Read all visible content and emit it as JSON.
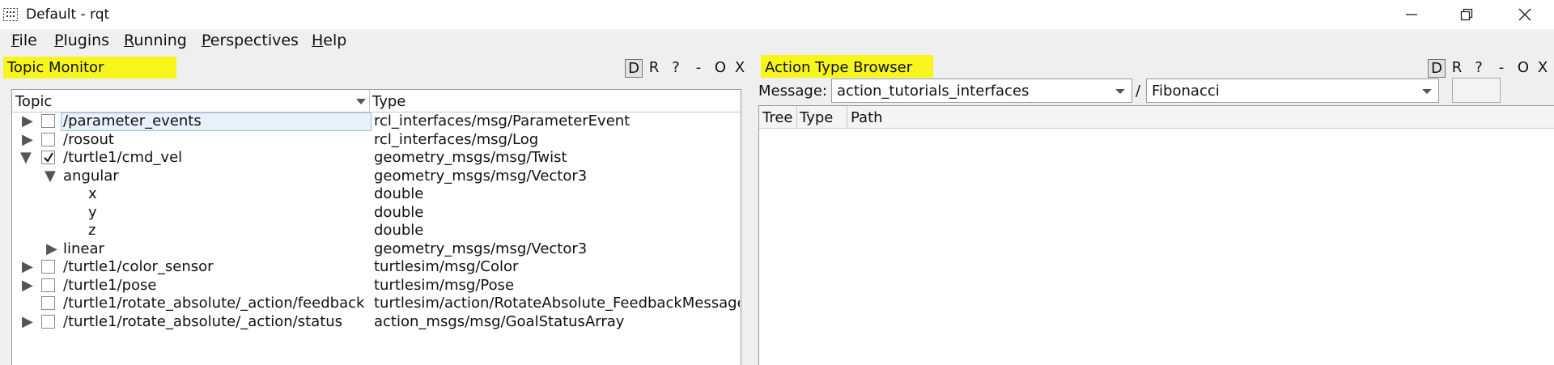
{
  "window": {
    "title": "Default - rqt",
    "minimize_glyph": "–",
    "restore_glyph": "❐",
    "close_glyph": "✕"
  },
  "menubar": [
    {
      "mnemonic": "F",
      "rest": "ile"
    },
    {
      "mnemonic": "P",
      "rest": "lugins"
    },
    {
      "mnemonic": "R",
      "rest": "unning"
    },
    {
      "mnemonic": "P",
      "rest": "erspectives"
    },
    {
      "mnemonic": "H",
      "rest": "elp"
    }
  ],
  "highlight_color": "#f6f61a",
  "topic_monitor": {
    "title": "Topic Monitor",
    "buttons": {
      "d": "D",
      "r": "R",
      "help": "?",
      "minimize": "-",
      "restore": "O",
      "close": "X"
    },
    "columns": {
      "topic": "Topic",
      "type": "Type"
    },
    "rows": [
      {
        "topic": "/parameter_events",
        "type": "rcl_interfaces/msg/ParameterEvent"
      },
      {
        "topic": "/rosout",
        "type": "rcl_interfaces/msg/Log"
      },
      {
        "topic": "/turtle1/cmd_vel",
        "type": "geometry_msgs/msg/Twist"
      },
      {
        "topic": "angular",
        "type": "geometry_msgs/msg/Vector3"
      },
      {
        "topic": "x",
        "type": "double"
      },
      {
        "topic": "y",
        "type": "double"
      },
      {
        "topic": "z",
        "type": "double"
      },
      {
        "topic": "linear",
        "type": "geometry_msgs/msg/Vector3"
      },
      {
        "topic": "/turtle1/color_sensor",
        "type": "turtlesim/msg/Color"
      },
      {
        "topic": "/turtle1/pose",
        "type": "turtlesim/msg/Pose"
      },
      {
        "topic": "/turtle1/rotate_absolute/_action/feedback",
        "type": "turtlesim/action/RotateAbsolute_FeedbackMessage"
      },
      {
        "topic": "/turtle1/rotate_absolute/_action/status",
        "type": "action_msgs/msg/GoalStatusArray"
      }
    ]
  },
  "action_browser": {
    "title": "Action Type Browser",
    "buttons": {
      "d": "D",
      "r": "R",
      "help": "?",
      "minimize": "-",
      "restore": "O",
      "close": "X"
    },
    "message_label": "Message:",
    "package": "action_tutorials_interfaces",
    "separator": "/",
    "action": "Fibonacci",
    "columns": {
      "tree": "Tree",
      "type": "Type",
      "path": "Path"
    }
  }
}
